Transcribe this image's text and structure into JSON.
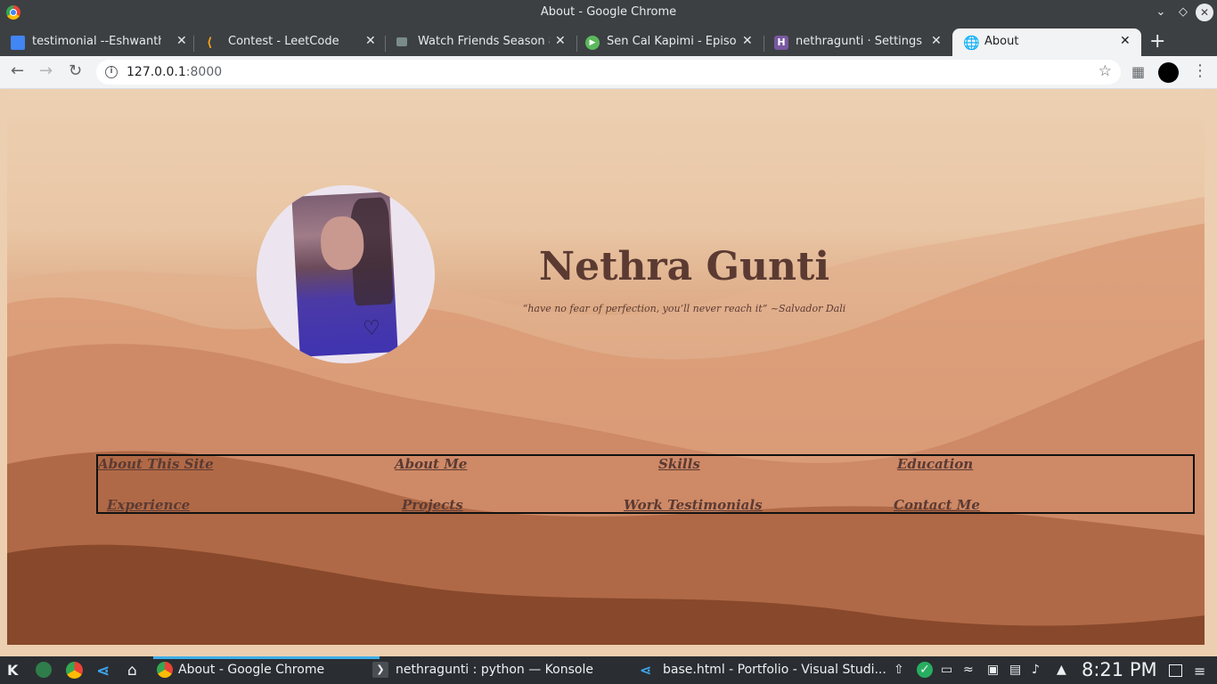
{
  "window": {
    "title": "About - Google Chrome"
  },
  "tabs": [
    {
      "label": "testimonial --Eshwanth -",
      "icon": "docs-icon"
    },
    {
      "label": "Contest - LeetCode",
      "icon": "leetcode-icon"
    },
    {
      "label": "Watch Friends Season 8 |",
      "icon": "video-icon"
    },
    {
      "label": "Sen Cal Kapimi - Episode",
      "icon": "play-icon"
    },
    {
      "label": "nethragunti · Settings | ",
      "icon": "heroku-icon"
    },
    {
      "label": "About",
      "icon": "globe-icon"
    }
  ],
  "toolbar": {
    "url_host": "127.0.0.1",
    "url_port": ":8000"
  },
  "page": {
    "name": "Nethra Gunti",
    "quote": "“have no fear of perfection, you’ll never reach it” ~Salvador Dali",
    "nav": [
      "About This Site",
      "About Me",
      "Skills",
      "Education",
      "Experience",
      "Projects",
      "Work Testimonials",
      "Contact Me"
    ]
  },
  "taskbar": {
    "tasks": [
      "About - Google Chrome",
      "nethragunti : python — Konsole",
      "base.html - Portfolio - Visual Studi..."
    ],
    "clock": "8:21 PM"
  },
  "colors": {
    "accent_text": "#5b3a32",
    "titlebar": "#3c4043",
    "taskbar": "#2a2e32"
  }
}
